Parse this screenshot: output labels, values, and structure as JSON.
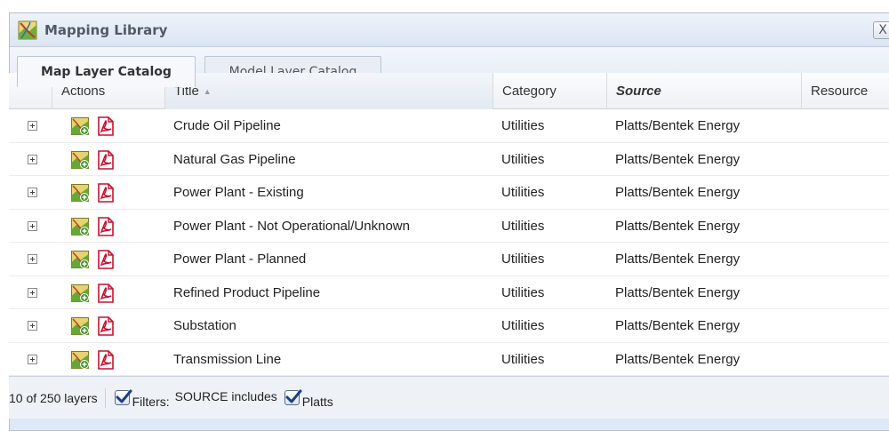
{
  "window": {
    "title": "Mapping Library",
    "close_label": "X"
  },
  "tabs": [
    {
      "label": "Map Layer Catalog",
      "active": true
    },
    {
      "label": "Model Layer Catalog",
      "active": false
    }
  ],
  "grid": {
    "columns": [
      "Actions",
      "Title",
      "Category",
      "Source",
      "Resource"
    ],
    "sorted_column": "Title",
    "sort_direction": "ascending",
    "rows": [
      {
        "title": "Crude Oil Pipeline",
        "category": "Utilities",
        "source": "Platts/Bentek Energy"
      },
      {
        "title": "Natural Gas Pipeline",
        "category": "Utilities",
        "source": "Platts/Bentek Energy"
      },
      {
        "title": "Power Plant - Existing",
        "category": "Utilities",
        "source": "Platts/Bentek Energy"
      },
      {
        "title": "Power Plant - Not Operational/Unknown",
        "category": "Utilities",
        "source": "Platts/Bentek Energy"
      },
      {
        "title": "Power Plant - Planned",
        "category": "Utilities",
        "source": "Platts/Bentek Energy"
      },
      {
        "title": "Refined Product Pipeline",
        "category": "Utilities",
        "source": "Platts/Bentek Energy"
      },
      {
        "title": "Substation",
        "category": "Utilities",
        "source": "Platts/Bentek Energy"
      },
      {
        "title": "Transmission Line",
        "category": "Utilities",
        "source": "Platts/Bentek Energy"
      }
    ]
  },
  "footer": {
    "count_text": "10 of 250 layers",
    "filters_label": "Filters:",
    "filter_text": "SOURCE includes",
    "platts_label": "Platts",
    "filters_checked": true,
    "platts_checked": true
  },
  "icons": {
    "app": "map-library-icon",
    "row_actions": [
      "add-layer-icon",
      "pdf-icon"
    ],
    "expander": "expand-plus-icon"
  },
  "colors": {
    "window_bg": "#dfe8f6",
    "pdf_red": "#c8102e",
    "checkmark_blue": "#1c3f86"
  }
}
